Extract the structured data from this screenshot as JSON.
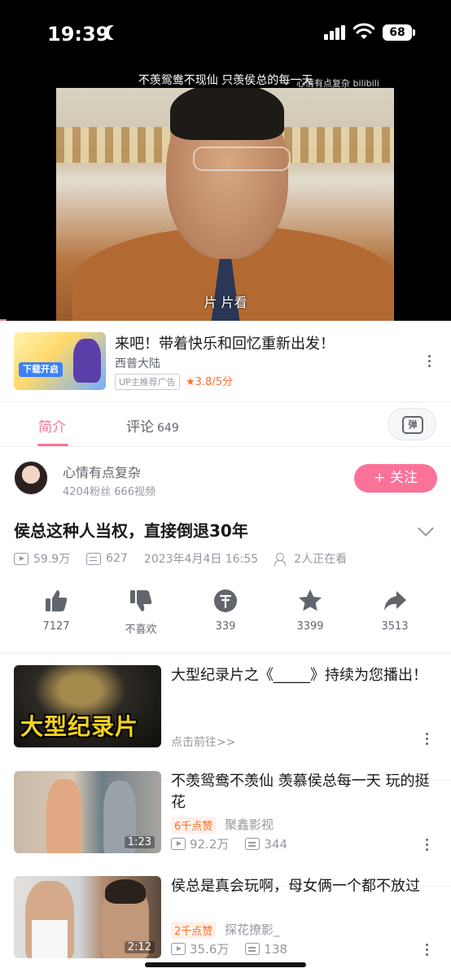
{
  "status": {
    "time": "19:39",
    "battery": "68",
    "colors": {
      "accent": "#fb7299",
      "muted": "#9499a0",
      "orange": "#ff6e2c"
    }
  },
  "video": {
    "title_overlay": "不羡鸳鸯不现仙 只羡侯总的每一天",
    "watermark": "心情有点复杂 bilibili",
    "subtitle": "片  片看",
    "progress": 0.015
  },
  "ad": {
    "title": "来吧！带着快乐和回忆重新出发！",
    "subtitle": "西普大陆",
    "badge": "UP主推荐广告",
    "rating": "★3.8/5分",
    "thumb_banner": "下载开启"
  },
  "tabs": {
    "intro": "简介",
    "comments": "评论",
    "comments_count": "649",
    "danmaku_icon": "弹"
  },
  "uploader": {
    "name": "心情有点复杂",
    "stats": "4204粉丝  666视频",
    "follow_label": "+ 关注"
  },
  "main": {
    "title": "侯总这种人当权，直接倒退30年",
    "views": "59.9万",
    "danmaku": "627",
    "date": "2023年4月4日 16:55",
    "watching": "2人正在看"
  },
  "actions": [
    {
      "icon": "thumbs-up-icon",
      "label": "7127"
    },
    {
      "icon": "thumbs-down-icon",
      "label": "不喜欢"
    },
    {
      "icon": "coin-icon",
      "label": "339"
    },
    {
      "icon": "star-icon",
      "label": "3399"
    },
    {
      "icon": "share-icon",
      "label": "3513"
    }
  ],
  "related": [
    {
      "title": "大型纪录片之《_____》持续为您播出！",
      "sub": "点击前往>>",
      "thumb_text": "大型纪录片"
    },
    {
      "title": "不羡鸳鸯不羡仙  羡慕侯总每一天  玩的挺花",
      "tag": "6千点赞",
      "up": "聚鑫影视",
      "views": "92.2万",
      "danmaku": "344",
      "duration": "1:23"
    },
    {
      "title": "侯总是真会玩啊，母女俩一个都不放过",
      "tag": "2千点赞",
      "up": "探花撩影_",
      "views": "35.6万",
      "danmaku": "138",
      "duration": "2:12"
    }
  ]
}
